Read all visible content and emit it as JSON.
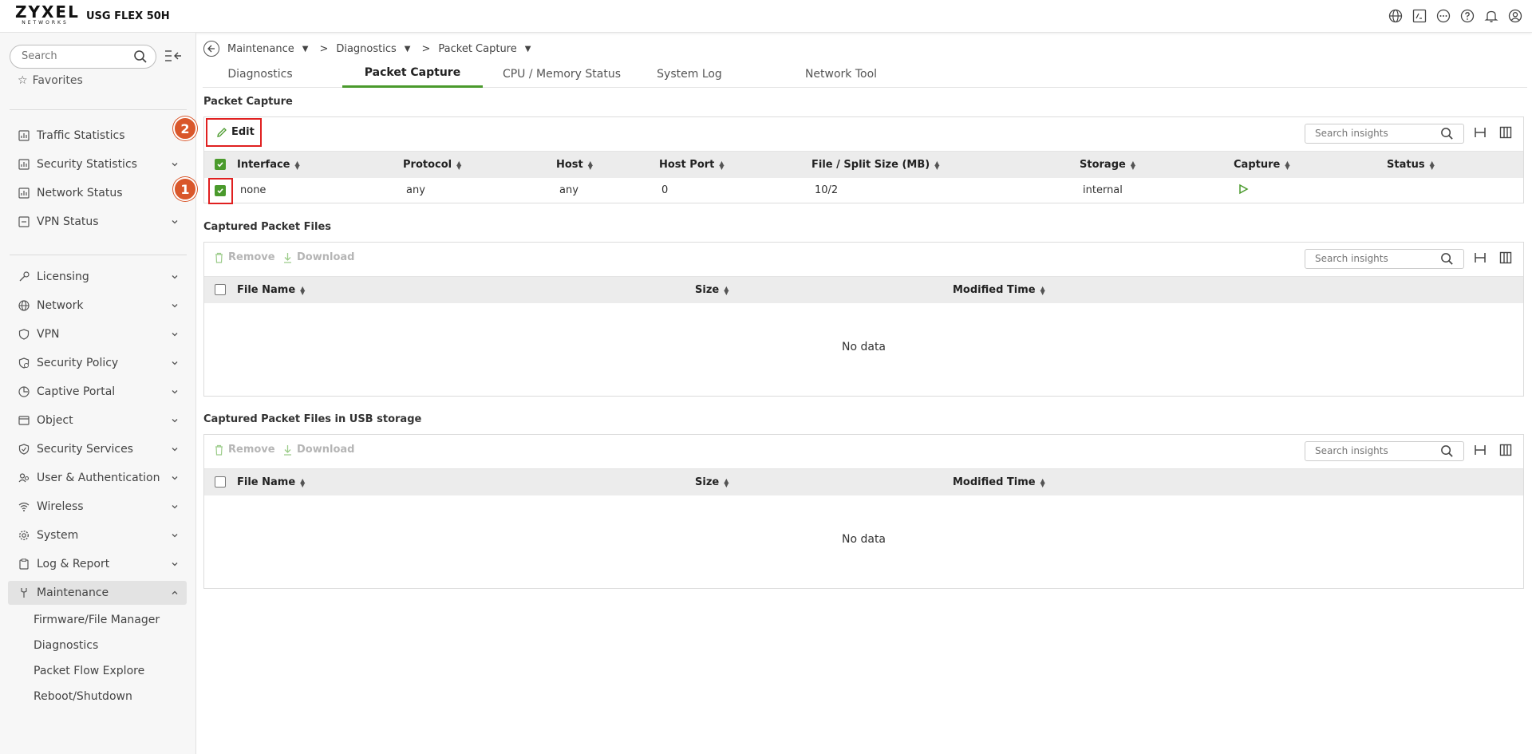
{
  "header": {
    "brand": "ZYXEL",
    "brand_sub": "NETWORKS",
    "model": "USG FLEX 50H",
    "icons": [
      "globe-icon",
      "terminal-icon",
      "more-icon",
      "help-icon",
      "bell-icon",
      "user-icon"
    ]
  },
  "sidebar": {
    "search_placeholder": "Search",
    "favorites_label": "Favorites",
    "items": [
      {
        "label": "Traffic Statistics",
        "icon": "chart-icon"
      },
      {
        "label": "Security Statistics",
        "icon": "chart-icon"
      },
      {
        "label": "Network Status",
        "icon": "chart-icon"
      },
      {
        "label": "VPN Status",
        "icon": "vpn-icon"
      },
      {
        "label": "Licensing",
        "icon": "key-icon"
      },
      {
        "label": "Network",
        "icon": "globe-icon"
      },
      {
        "label": "VPN",
        "icon": "shield-icon"
      },
      {
        "label": "Security Policy",
        "icon": "policy-icon"
      },
      {
        "label": "Captive Portal",
        "icon": "portal-icon"
      },
      {
        "label": "Object",
        "icon": "object-icon"
      },
      {
        "label": "Security Services",
        "icon": "shield-icon"
      },
      {
        "label": "User & Authentication",
        "icon": "users-icon"
      },
      {
        "label": "Wireless",
        "icon": "wifi-icon"
      },
      {
        "label": "System",
        "icon": "gear-icon"
      },
      {
        "label": "Log & Report",
        "icon": "clipboard-icon"
      },
      {
        "label": "Maintenance",
        "icon": "tool-icon"
      }
    ],
    "maintenance_sub": [
      "Firmware/File Manager",
      "Diagnostics",
      "Packet Flow Explore",
      "Reboot/Shutdown"
    ]
  },
  "breadcrumb": [
    "Maintenance",
    "Diagnostics",
    "Packet Capture"
  ],
  "tabs": [
    "Diagnostics",
    "Packet Capture",
    "CPU / Memory Status",
    "System Log",
    "Network Tool"
  ],
  "packet_capture": {
    "title": "Packet Capture",
    "edit_label": "Edit",
    "search_placeholder": "Search insights",
    "columns": [
      "Interface",
      "Protocol",
      "Host",
      "Host Port",
      "File / Split Size (MB)",
      "Storage",
      "Capture",
      "Status"
    ],
    "row": {
      "interface": "none",
      "protocol": "any",
      "host": "any",
      "host_port": "0",
      "file_size": "10/2",
      "storage": "internal",
      "status": ""
    }
  },
  "captured_files": {
    "title": "Captured Packet Files",
    "remove_label": "Remove",
    "download_label": "Download",
    "search_placeholder": "Search insights",
    "columns": [
      "File Name",
      "Size",
      "Modified Time"
    ],
    "empty_text": "No data"
  },
  "usb_files": {
    "title": "Captured Packet Files in USB storage",
    "remove_label": "Remove",
    "download_label": "Download",
    "search_placeholder": "Search insights",
    "columns": [
      "File Name",
      "Size",
      "Modified Time"
    ],
    "empty_text": "No data"
  },
  "annotations": {
    "badge1": "1",
    "badge2": "2",
    "color": "#e02020"
  },
  "colors": {
    "accent": "#4a9a2c",
    "badge": "#d9572b"
  }
}
